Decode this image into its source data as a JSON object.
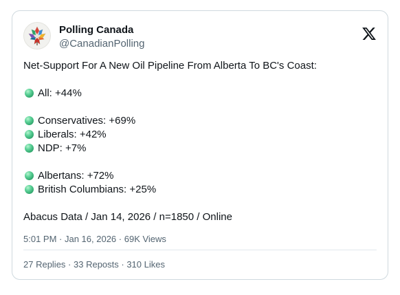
{
  "author": {
    "name": "Polling Canada",
    "handle": "@CanadianPolling",
    "avatar_icon": "polling-canada-maple-logo"
  },
  "platform_icon": "x-logo-icon",
  "tweet": {
    "headline": "Net-Support For A New Oil Pipeline From Alberta To BC's Coast:",
    "bullet_color": "#3fbf80",
    "groups": [
      [
        "All: +44%"
      ],
      [
        "Conservatives: +69%",
        "Liberals: +42%",
        "NDP: +7%"
      ],
      [
        "Albertans: +72%",
        "British Columbians: +25%"
      ]
    ],
    "source": "Abacus Data / Jan 14, 2026 / n=1850 / Online"
  },
  "meta": {
    "time": "5:01 PM",
    "date": "Jan 16, 2026",
    "views": "69K Views"
  },
  "engagement": {
    "replies": "27 Replies",
    "reposts": "33 Reposts",
    "likes": "310 Likes"
  }
}
